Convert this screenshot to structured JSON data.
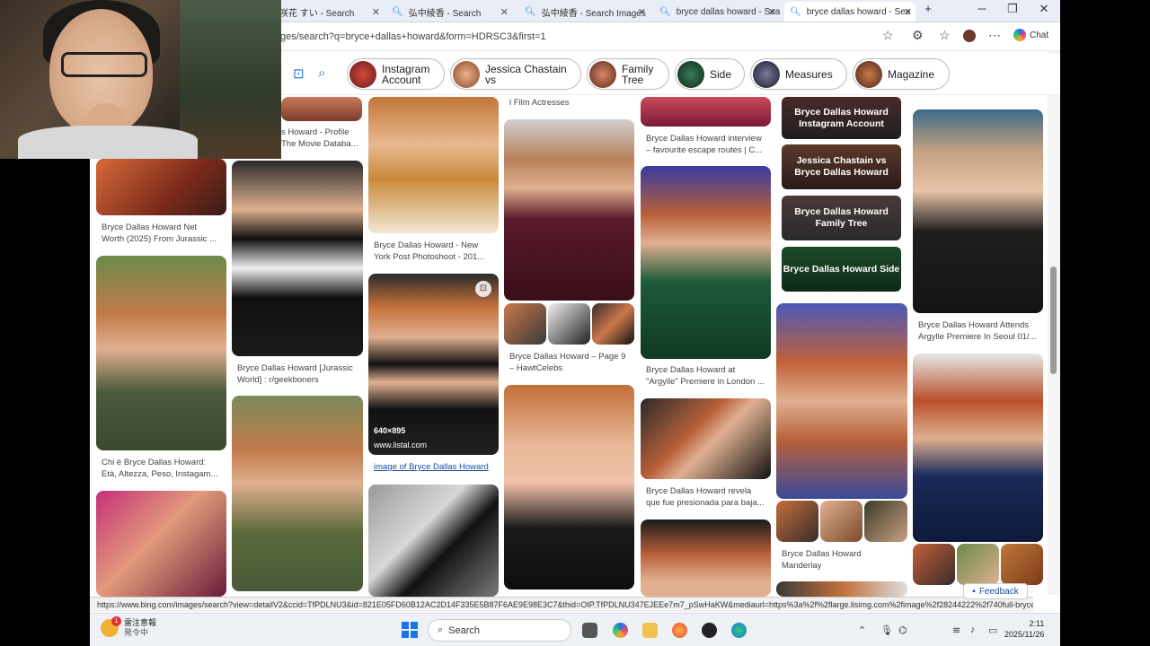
{
  "browser": {
    "tabs": [
      {
        "label": "咲花 すい - Search"
      },
      {
        "label": "弘中綾香 - Search"
      },
      {
        "label": "弘中綾香 - Search Images"
      },
      {
        "label": "bryce dallas howard - Sea"
      },
      {
        "label": "bryce dallas howard - Sea"
      }
    ],
    "new_tab": "+",
    "address": "ges/search?q=bryce+dallas+howard&form=HDRSC3&first=1",
    "chat_label": "Chat"
  },
  "chips": [
    {
      "label": "Instagram Account",
      "color": "#8a2a2a"
    },
    {
      "label": "Jessica Chastain vs",
      "color": "#b0673f"
    },
    {
      "label": "Family Tree",
      "color": "#a05a3e"
    },
    {
      "label": "Side",
      "color": "#1e5a3a"
    },
    {
      "label": "Measures",
      "color": "#3a3a5a"
    },
    {
      "label": "Magazine",
      "color": "#8a4a2a"
    }
  ],
  "results": {
    "col1": [
      {
        "caption": "s Howard - Profile\nThe Movie Databa..."
      },
      {
        "caption": "Bryce Dallas Howard Net\nWorth (2025) From Jurassic ..."
      },
      {
        "caption": "Chi è Bryce Dallas Howard:\nEtà, Altezza, Peso, Instagam..."
      }
    ],
    "col2": [
      {
        "caption": "Bryce Dallas Howard [Jurassic\nWorld] : r/geekboners"
      }
    ],
    "col3": [
      {
        "caption": "Bryce Dallas Howard - New\nYork Post Photoshoot - 201..."
      },
      {
        "size": "640×895",
        "source": "www.listal.com",
        "caption": "image of Bryce Dallas Howard"
      }
    ],
    "col4": [
      {
        "caption": "l Film Actresses"
      },
      {
        "caption": "Bryce Dallas Howard – Page 9\n– HawtCelebs"
      }
    ],
    "col5": [
      {
        "caption": "Bryce Dallas Howard interview\n– favourite escape routes | C..."
      },
      {
        "caption": "Bryce Dallas Howard at\n\"Argylle\" Premiere in London ..."
      },
      {
        "caption": "Bryce Dallas Howard revela\nque fue presionada para baja..."
      }
    ],
    "col6": {
      "related": [
        {
          "label": "Bryce Dallas Howard\nInstagram Account"
        },
        {
          "label": "Jessica Chastain vs\nBryce Dallas Howard"
        },
        {
          "label": "Bryce Dallas Howard\nFamily Tree"
        },
        {
          "label": "Bryce Dallas Howard Side"
        }
      ],
      "caption": "Bryce Dallas Howard\nManderlay"
    },
    "col7": [
      {
        "caption": "Bryce Dallas Howard Attends\nArgylle Premiere In Seoul 01/..."
      }
    ]
  },
  "status_url": "https://www.bing.com/images/search?view=detailV2&ccid=TfPDLNU3&id=821E05FD60B12AC2D14F335E5B87F6AE9E98E3C7&thid=OIP.TfPDLNU347EJEEe7m7_pSwHaKW&mediaurl=https%3a%2f%2flarge.lisimg.com%2fimage%2f28244222%2f740full-bryce-dal...",
  "feedback_label": "Feedback",
  "taskbar": {
    "weather_line1": "雷注意報",
    "weather_line2": "発令中",
    "alert_count": "1",
    "search_label": "Search",
    "time": "2:11",
    "date": "2025/11/26"
  }
}
